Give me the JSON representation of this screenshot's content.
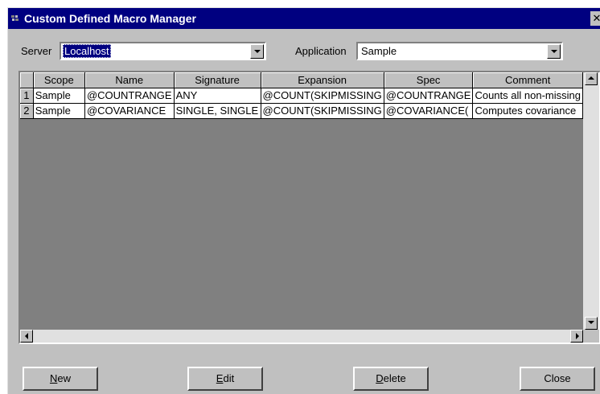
{
  "window": {
    "title": "Custom Defined Macro Manager",
    "close_glyph": "✕"
  },
  "filters": {
    "server_label": "Server",
    "server_value": "Localhost",
    "application_label": "Application",
    "application_value": "Sample"
  },
  "grid": {
    "columns": [
      "Scope",
      "Name",
      "Signature",
      "Expansion",
      "Spec",
      "Comment"
    ],
    "rows": [
      {
        "num": "1",
        "cells": [
          "Sample",
          "@COUNTRANGE",
          "ANY",
          "@COUNT(SKIPMISSING",
          "@COUNTRANGE",
          "Counts all non-missing"
        ]
      },
      {
        "num": "2",
        "cells": [
          "Sample",
          "@COVARIANCE",
          "SINGLE, SINGLE",
          "@COUNT(SKIPMISSING",
          "@COVARIANCE(",
          "Computes covariance"
        ]
      }
    ]
  },
  "buttons": {
    "new_mnemonic": "N",
    "new_rest": "ew",
    "edit_mnemonic": "E",
    "edit_rest": "dit",
    "delete_mnemonic": "D",
    "delete_rest": "elete",
    "close": "Close"
  },
  "icons": {
    "app": "app-icon",
    "dropdown": "triangle-down-icon",
    "scroll_up": "triangle-up-icon",
    "scroll_down": "triangle-down-icon",
    "scroll_left": "triangle-left-icon",
    "scroll_right": "triangle-right-icon"
  },
  "colors": {
    "titlebar": "#000080",
    "face": "#c0c0c0",
    "selection": "#000080"
  }
}
